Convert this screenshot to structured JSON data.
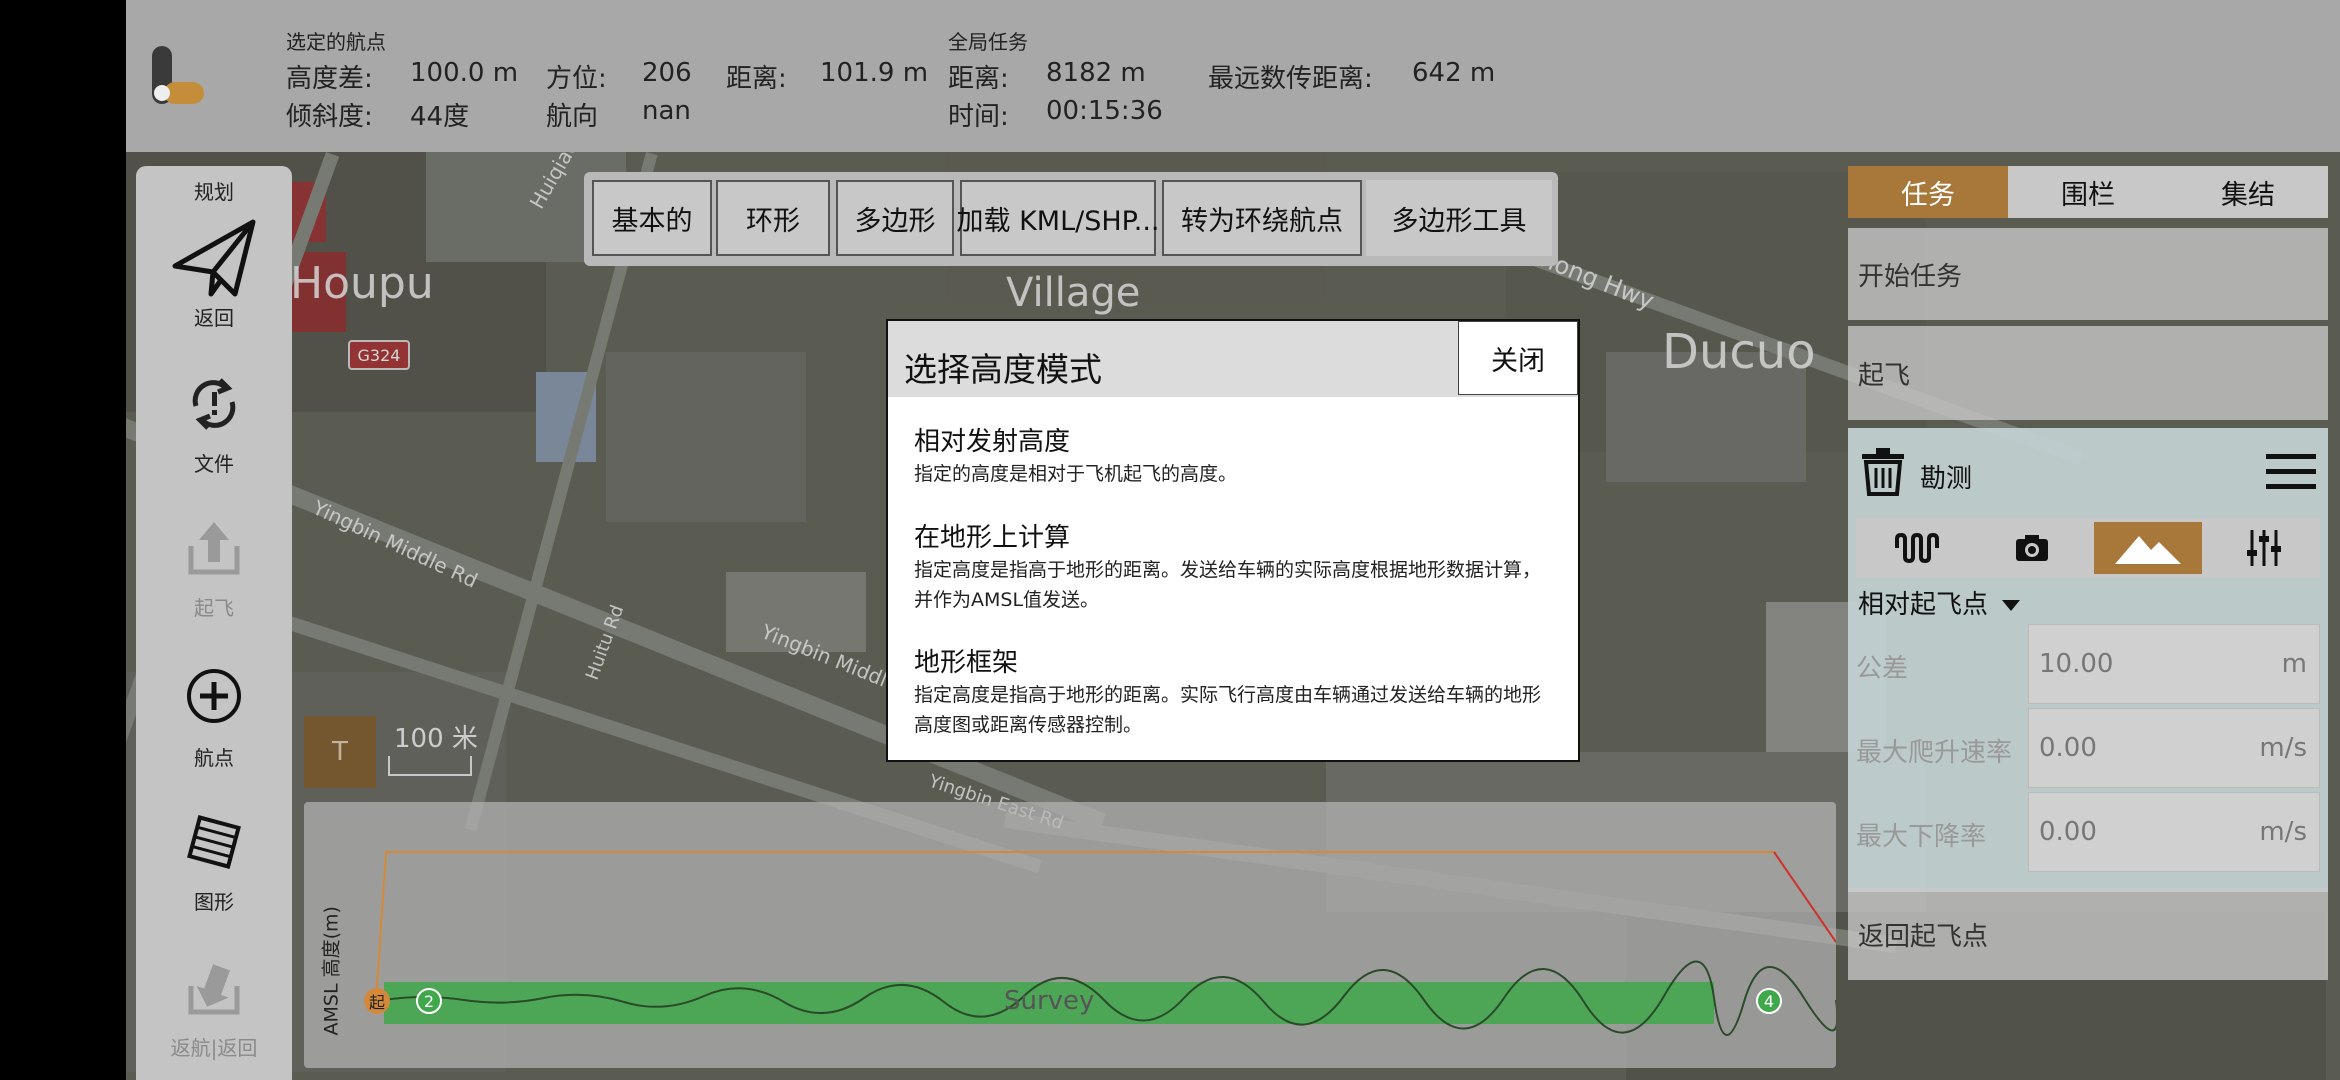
{
  "top_info": {
    "selected_waypoint": {
      "section_label": "选定的航点",
      "alt_diff_label": "高度差:",
      "alt_diff_value": "100.0 m",
      "azimuth_label": "方位:",
      "azimuth_value": "206",
      "distance_label": "距离:",
      "distance_value": "101.9 m",
      "gradient_label": "倾斜度:",
      "gradient_value": "44度",
      "heading_label": "航向",
      "heading_value": "nan"
    },
    "mission": {
      "section_label": "全局任务",
      "distance_label": "距离:",
      "distance_value": "8182 m",
      "max_telem_label": "最远数传距离:",
      "max_telem_value": "642 m",
      "time_label": "时间:",
      "time_value": "00:15:36"
    }
  },
  "left_toolbar": {
    "header": "规划",
    "items": [
      {
        "label": "返回",
        "icon": "paper-plane-icon",
        "enabled": true
      },
      {
        "label": "文件",
        "icon": "sync-file-icon",
        "enabled": true
      },
      {
        "label": "起飞",
        "icon": "takeoff-upload-icon",
        "enabled": false
      },
      {
        "label": "航点",
        "icon": "plus-circle-icon",
        "enabled": true
      },
      {
        "label": "图形",
        "icon": "pattern-stack-icon",
        "enabled": true
      },
      {
        "label": "返航|返回",
        "icon": "return-icon",
        "enabled": false
      }
    ]
  },
  "pattern_toolbar": {
    "buttons": [
      "基本的",
      "环形",
      "多边形",
      "加载 KML/SHP...",
      "转为环绕航点",
      "多边形工具"
    ]
  },
  "map": {
    "labels": [
      "Houpu",
      "Ducuo",
      "Village",
      "Huichong Hwy",
      "Yingbin Middle Rd",
      "Huitu Rd",
      "Yingbin East Rd",
      "Huiqiao"
    ],
    "badge": "G324",
    "scale_label": "100 米",
    "t_button": "T"
  },
  "right_panel": {
    "tabs": [
      "任务",
      "围栏",
      "集结"
    ],
    "selected_tab": "任务",
    "start_mission": "开始任务",
    "takeoff": "起飞",
    "survey": {
      "title": "勘测",
      "altitude_mode": "相对起飞点",
      "fields": [
        {
          "label": "公差",
          "value": "10.00",
          "unit": "m"
        },
        {
          "label": "最大爬升速率",
          "value": "0.00",
          "unit": "m/s"
        },
        {
          "label": "最大下降率",
          "value": "0.00",
          "unit": "m/s"
        }
      ]
    },
    "return_home": "返回起飞点"
  },
  "profile": {
    "ylabel": "AMSL 高度(m)",
    "center_label": "Survey",
    "markers": [
      "起",
      "2",
      "4"
    ]
  },
  "modal": {
    "title": "选择高度模式",
    "close_label": "关闭",
    "options": [
      {
        "title": "相对发射高度",
        "desc": "指定的高度是相对于飞机起飞的高度。"
      },
      {
        "title": "在地形上计算",
        "desc": "指定高度是指高于地形的距离。发送给车辆的实际高度根据地形数据计算，并作为AMSL值发送。"
      },
      {
        "title": "地形框架",
        "desc": "指定高度是指高于地形的距离。实际飞行高度由车辆通过发送给车辆的地形高度图或距离传感器控制。"
      }
    ]
  },
  "colors": {
    "accent": "#a8773a",
    "profile_line": "#d4893a",
    "survey_band": "#3fa84a"
  }
}
